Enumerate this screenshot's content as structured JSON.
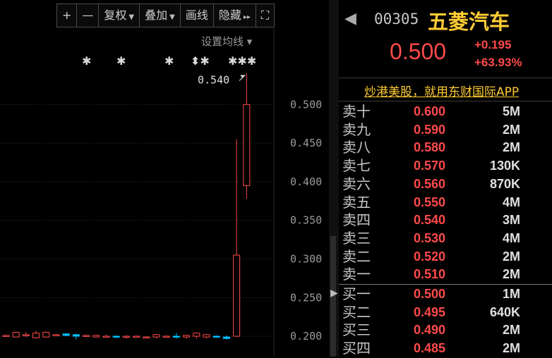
{
  "toolbar": {
    "items": [
      {
        "label": "+",
        "caret": ""
      },
      {
        "label": "—",
        "caret": ""
      },
      {
        "label": "复权",
        "caret": "▼"
      },
      {
        "label": "叠加",
        "caret": "▼"
      },
      {
        "label": "画线",
        "caret": ""
      },
      {
        "label": "隐藏",
        "caret": "▸▸"
      },
      {
        "label": "⛶",
        "caret": ""
      }
    ]
  },
  "ma_settings": "设置均线 ▾",
  "colors": {
    "up": "#ff4a4a",
    "down": "#00c0ff",
    "grid": "#3a3a3a",
    "gold": "#ffcc33"
  },
  "chart_data": {
    "type": "candlestick",
    "y_ticks": [
      "0.500",
      "0.450",
      "0.400",
      "0.350",
      "0.300",
      "0.250",
      "0.200"
    ],
    "ylim": [
      0.185,
      0.545
    ],
    "high_marker": "0.540",
    "event_markers": [
      "✱",
      "✱",
      "✱",
      "⬍✱",
      "✱✱✱"
    ],
    "candles": [
      {
        "o": 0.201,
        "h": 0.202,
        "l": 0.2,
        "c": 0.201
      },
      {
        "o": 0.199,
        "h": 0.205,
        "l": 0.198,
        "c": 0.205
      },
      {
        "o": 0.202,
        "h": 0.205,
        "l": 0.199,
        "c": 0.202
      },
      {
        "o": 0.198,
        "h": 0.207,
        "l": 0.197,
        "c": 0.204
      },
      {
        "o": 0.199,
        "h": 0.206,
        "l": 0.198,
        "c": 0.205
      },
      {
        "o": 0.202,
        "h": 0.203,
        "l": 0.201,
        "c": 0.202
      },
      {
        "o": 0.203,
        "h": 0.204,
        "l": 0.2,
        "c": 0.201
      },
      {
        "o": 0.202,
        "h": 0.203,
        "l": 0.196,
        "c": 0.2
      },
      {
        "o": 0.201,
        "h": 0.202,
        "l": 0.2,
        "c": 0.201
      },
      {
        "o": 0.199,
        "h": 0.202,
        "l": 0.198,
        "c": 0.201
      },
      {
        "o": 0.2,
        "h": 0.202,
        "l": 0.199,
        "c": 0.2
      },
      {
        "o": 0.2,
        "h": 0.201,
        "l": 0.198,
        "c": 0.199
      },
      {
        "o": 0.199,
        "h": 0.201,
        "l": 0.197,
        "c": 0.2
      },
      {
        "o": 0.2,
        "h": 0.201,
        "l": 0.199,
        "c": 0.2
      },
      {
        "o": 0.199,
        "h": 0.2,
        "l": 0.198,
        "c": 0.199
      },
      {
        "o": 0.199,
        "h": 0.203,
        "l": 0.197,
        "c": 0.202
      },
      {
        "o": 0.2,
        "h": 0.201,
        "l": 0.199,
        "c": 0.2
      },
      {
        "o": 0.2,
        "h": 0.204,
        "l": 0.197,
        "c": 0.199
      },
      {
        "o": 0.199,
        "h": 0.202,
        "l": 0.197,
        "c": 0.201
      },
      {
        "o": 0.2,
        "h": 0.204,
        "l": 0.197,
        "c": 0.204
      },
      {
        "o": 0.199,
        "h": 0.203,
        "l": 0.197,
        "c": 0.202
      },
      {
        "o": 0.2,
        "h": 0.201,
        "l": 0.198,
        "c": 0.199
      },
      {
        "o": 0.199,
        "h": 0.201,
        "l": 0.196,
        "c": 0.197
      },
      {
        "o": 0.2,
        "h": 0.455,
        "l": 0.199,
        "c": 0.305
      },
      {
        "o": 0.395,
        "h": 0.54,
        "l": 0.378,
        "c": 0.5
      }
    ]
  },
  "header": {
    "nav_arrow": "◀",
    "code": "00305",
    "name": "五菱汽车",
    "price": "0.500",
    "change": "+0.195",
    "change_pct": "+63.93%"
  },
  "ad": {
    "text": "炒港美股，就用东财国际APP"
  },
  "orderbook": {
    "asks": [
      {
        "label": "卖十",
        "price": "0.600",
        "volume": "5M"
      },
      {
        "label": "卖九",
        "price": "0.590",
        "volume": "2M"
      },
      {
        "label": "卖八",
        "price": "0.580",
        "volume": "2M"
      },
      {
        "label": "卖七",
        "price": "0.570",
        "volume": "130K"
      },
      {
        "label": "卖六",
        "price": "0.560",
        "volume": "870K"
      },
      {
        "label": "卖五",
        "price": "0.550",
        "volume": "4M"
      },
      {
        "label": "卖四",
        "price": "0.540",
        "volume": "3M"
      },
      {
        "label": "卖三",
        "price": "0.530",
        "volume": "4M"
      },
      {
        "label": "卖二",
        "price": "0.520",
        "volume": "2M"
      },
      {
        "label": "卖一",
        "price": "0.510",
        "volume": "2M"
      }
    ],
    "bids": [
      {
        "label": "买一",
        "price": "0.500",
        "volume": "1M"
      },
      {
        "label": "买二",
        "price": "0.495",
        "volume": "640K"
      },
      {
        "label": "买三",
        "price": "0.490",
        "volume": "2M"
      },
      {
        "label": "买四",
        "price": "0.485",
        "volume": "2M"
      }
    ]
  }
}
